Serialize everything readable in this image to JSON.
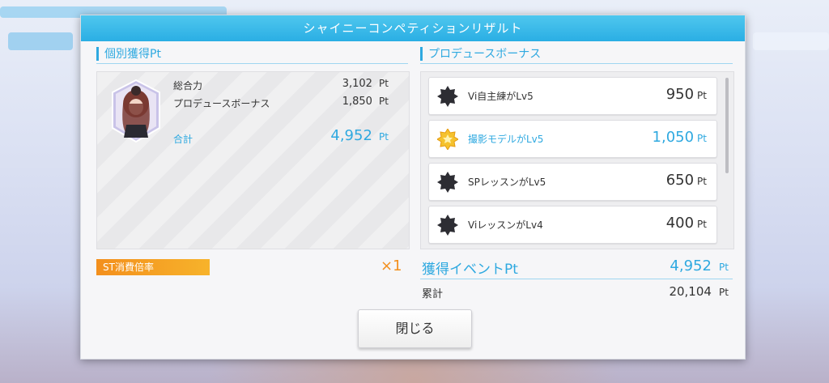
{
  "dialog": {
    "title": "シャイニーコンペティションリザルト",
    "close_label": "閉じる"
  },
  "individual": {
    "heading": "個別獲得Pt",
    "rows": [
      {
        "label": "総合力",
        "value": "3,102",
        "unit": "Pt"
      },
      {
        "label": "プロデュースボーナス",
        "value": "1,850",
        "unit": "Pt"
      }
    ],
    "total_label": "合計",
    "total_value": "4,952",
    "total_unit": "Pt"
  },
  "bonus": {
    "heading": "プロデュースボーナス",
    "items": [
      {
        "name": "Vi自主練がLv5",
        "pt": "950",
        "unit": "Pt",
        "icon": "dark-badge-icon",
        "highlight": false
      },
      {
        "name": "撮影モデルがLv5",
        "pt": "1,050",
        "unit": "Pt",
        "icon": "gold-badge-icon",
        "highlight": true
      },
      {
        "name": "SPレッスンがLv5",
        "pt": "650",
        "unit": "Pt",
        "icon": "dark-badge-icon",
        "highlight": false
      },
      {
        "name": "ViレッスンがLv4",
        "pt": "400",
        "unit": "Pt",
        "icon": "dark-badge-icon",
        "highlight": false
      }
    ]
  },
  "st": {
    "label": "ST消費倍率",
    "multiplier": "×1"
  },
  "event": {
    "label": "獲得イベントPt",
    "value": "4,952",
    "unit": "Pt",
    "cumulative_label": "累計",
    "cumulative_value": "20,104",
    "cumulative_unit": "Pt"
  },
  "colors": {
    "accent": "#2fa9e0",
    "st_orange": "#f38f1d"
  }
}
